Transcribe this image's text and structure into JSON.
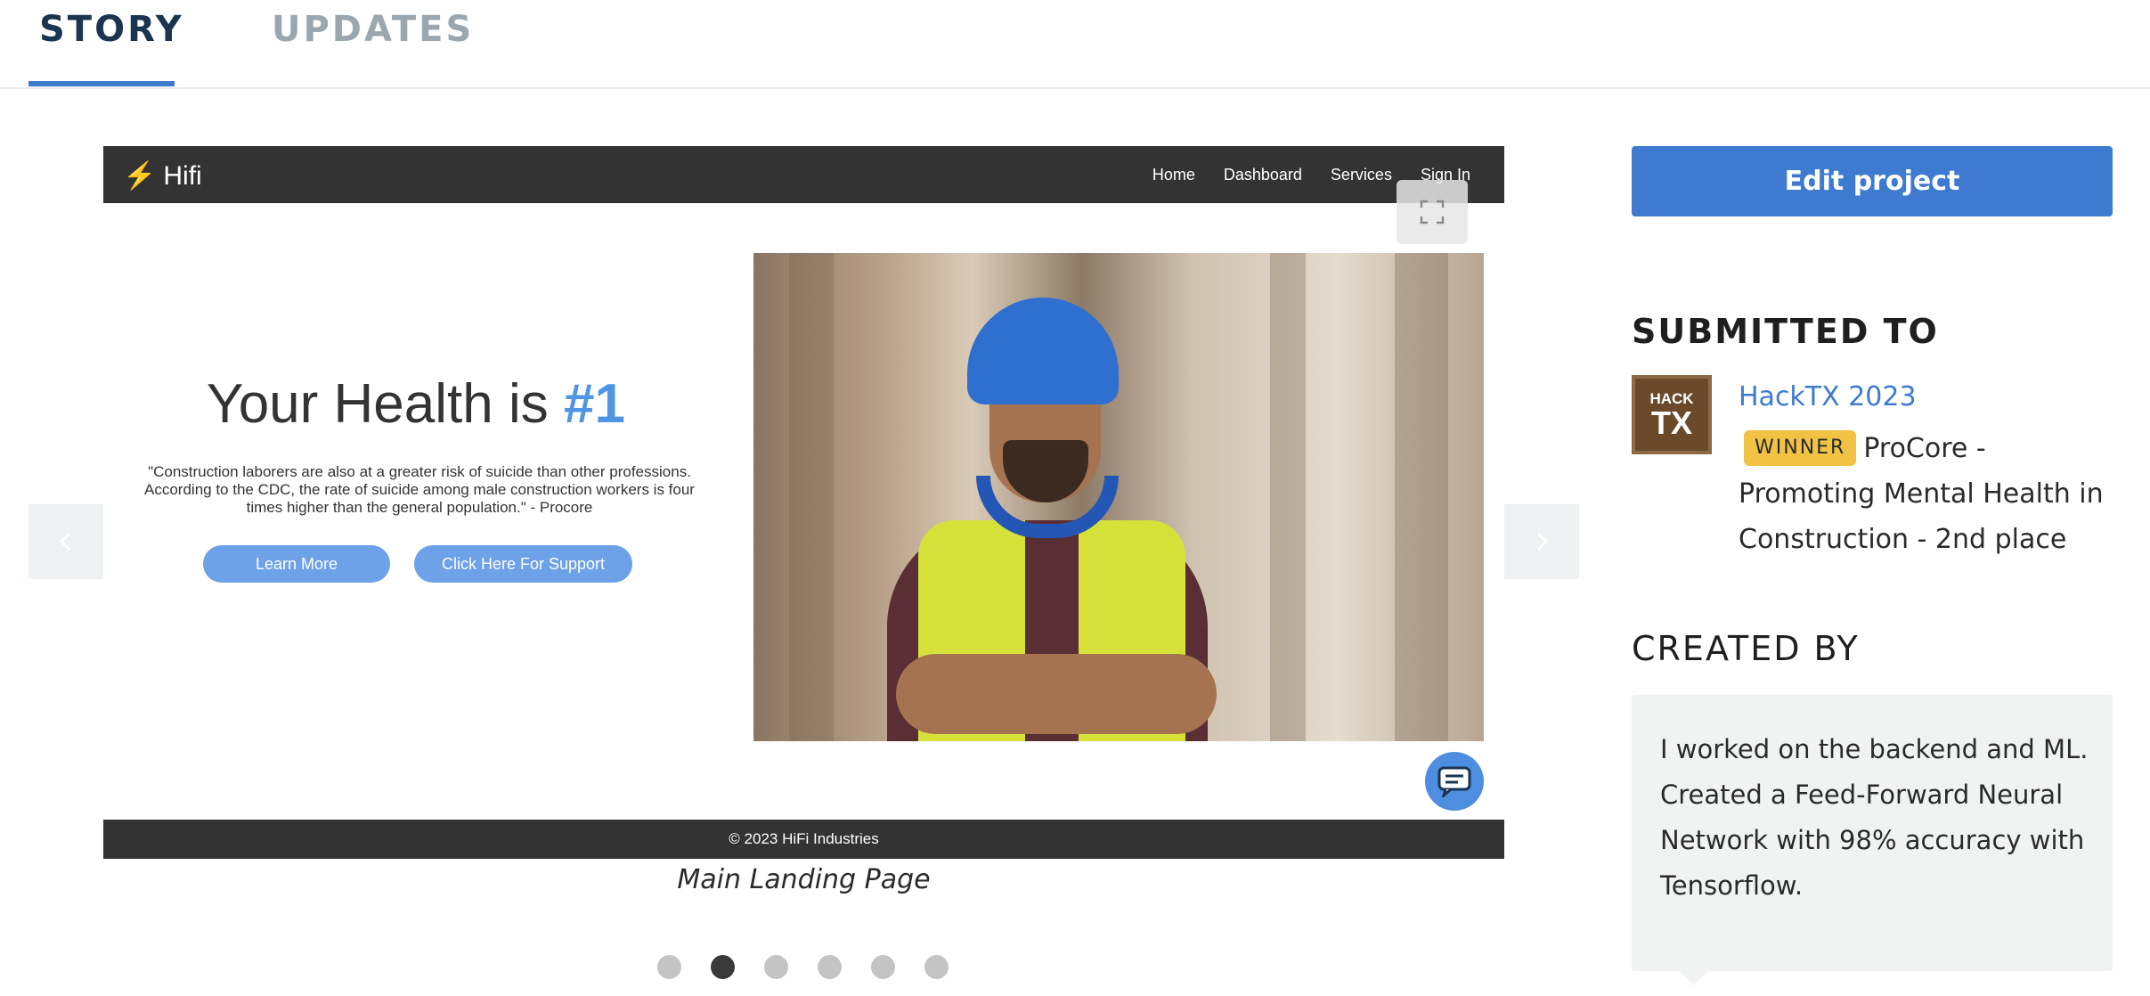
{
  "tabs": [
    {
      "label": "STORY",
      "active": true
    },
    {
      "label": "UPDATES",
      "active": false
    }
  ],
  "gallery": {
    "slide": {
      "nav": {
        "logo": "Hifi",
        "links": [
          "Home",
          "Dashboard",
          "Services",
          "Sign In"
        ]
      },
      "hero": {
        "title": "Your Health is",
        "title_accent": "#1",
        "quote": "\"Construction laborers are also at a greater risk of suicide than other professions. According to the CDC, the rate of suicide among male construction workers is four times higher than the general population.\" - Procore",
        "buttons": [
          "Learn More",
          "Click Here For Support"
        ]
      },
      "footer": "© 2023 HiFi Industries"
    },
    "caption": "Main Landing Page",
    "dots_total": 6,
    "active_dot": 2,
    "icons": {
      "prev": "chevron-left-icon",
      "next": "chevron-right-icon",
      "expand": "expand-icon",
      "chat": "chat-icon"
    }
  },
  "sidebar": {
    "edit_button": "Edit project",
    "submitted_to": {
      "title": "SUBMITTED TO",
      "logo_line1": "HACK",
      "logo_line2": "TX",
      "hackathon": "HackTX 2023",
      "badge": "WINNER",
      "prize": "ProCore - Promoting Mental Health in Construction - 2nd place"
    },
    "created_by": {
      "title": "CREATED BY",
      "text": "I worked on the backend and ML. Created a Feed-Forward Neural Network with 98% accuracy with Tensorflow."
    }
  },
  "colors": {
    "accent": "#3e7bd0",
    "tab_active": "#1b3550",
    "winner_badge": "#f2c244"
  }
}
